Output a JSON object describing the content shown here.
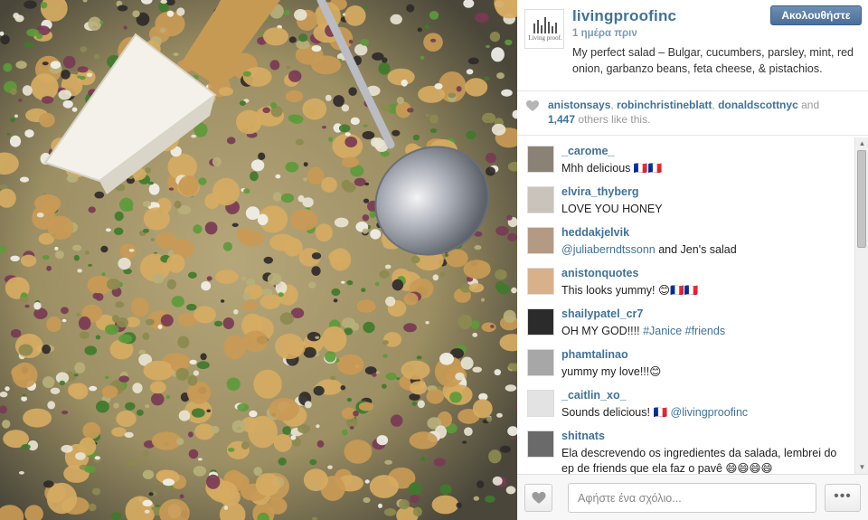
{
  "post": {
    "username": "livingproofinc",
    "logo_text": "Living proof.",
    "time": "1 ημέρα πριν",
    "caption": "My perfect salad – Bulgar, cucumbers, parsley, mint, red onion, garbanzo beans, feta cheese, & pistachios.",
    "follow_label": "Ακολουθήστε"
  },
  "likes": {
    "names": [
      "anistonsays",
      "robinchristineblatt",
      "donaldscottnyc"
    ],
    "and_text": "and",
    "count": "1,447",
    "suffix": "others like this."
  },
  "comments": [
    {
      "user": "_carome_",
      "text": "Mhh delicious 🇫🇷🇫🇷",
      "avatar_color": "#8a8275"
    },
    {
      "user": "elvira_thyberg",
      "text": "LOVE YOU HONEY",
      "avatar_color": "#c9c3bb"
    },
    {
      "user": "heddakjelvik",
      "mention": "@juliaberndtssonn",
      "text": " and Jen's salad",
      "avatar_color": "#b49a84"
    },
    {
      "user": "anistonquotes",
      "text": "This looks yummy! 😊🇫🇷🇫🇷",
      "avatar_color": "#d8b08a"
    },
    {
      "user": "shailypatel_cr7",
      "text": "OH MY GOD!!!! ",
      "tags": "#Janice #friends",
      "avatar_color": "#2b2b2b"
    },
    {
      "user": "phamtalinao",
      "text": "yummy my love!!!😊",
      "avatar_color": "#a7a7a7"
    },
    {
      "user": "_caitlin_xo_",
      "text": "Sounds delicious! 🇫🇷 ",
      "mention": "@livingproofinc",
      "avatar_color": "#e3e3e3"
    },
    {
      "user": "shitnats",
      "text": "Ela descrevendo os ingredientes da salada, lembrei do ep de friends que ela faz o pavê 😄😄😄😄",
      "avatar_color": "#6a6a6a"
    }
  ],
  "footer": {
    "comment_placeholder": "Αφήστε ένα σχόλιο...",
    "more_label": "•••"
  },
  "icons": {
    "like": "heart-icon",
    "more": "more-options-icon"
  }
}
